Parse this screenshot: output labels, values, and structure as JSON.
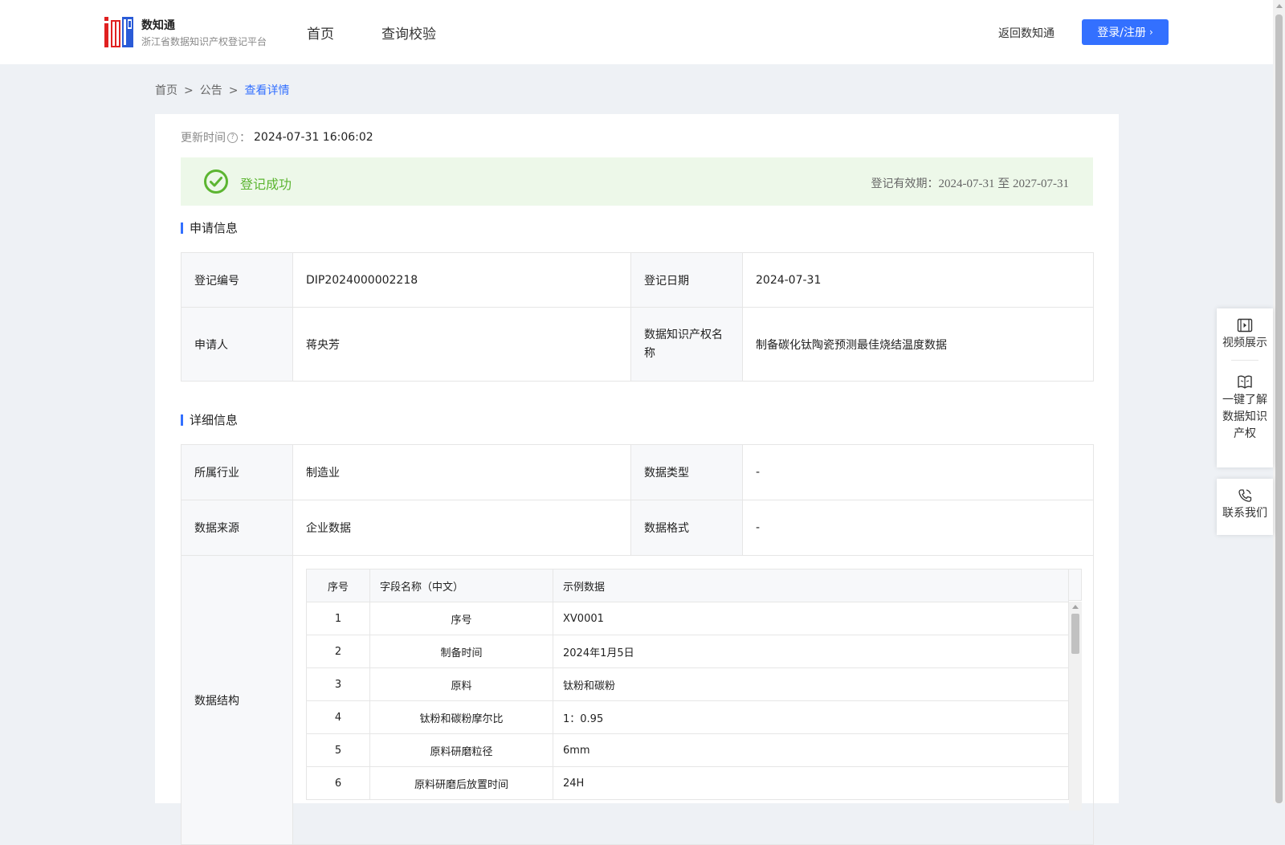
{
  "header": {
    "logo_title": "数知通",
    "logo_subtitle": "浙江省数据知识产权登记平台",
    "nav": [
      "首页",
      "查询校验"
    ],
    "back_link": "返回数知通",
    "login_button": "登录/注册"
  },
  "breadcrumb": [
    "首页",
    "公告",
    "查看详情"
  ],
  "update": {
    "label": "更新时间",
    "suffix": "：",
    "value": "2024-07-31 16:06:02"
  },
  "status": {
    "text": "登记成功",
    "validity_label": "登记有效期：",
    "validity_range": "2024-07-31 至 2027-07-31",
    "color": "#5cb531"
  },
  "apply_info": {
    "title": "申请信息",
    "rows": [
      {
        "label1": "登记编号",
        "value1": "DIP2024000002218",
        "label2": "登记日期",
        "value2": "2024-07-31"
      },
      {
        "label1": "申请人",
        "value1": "蒋央芳",
        "label2": "数据知识产权名称",
        "value2": "制备碳化钛陶瓷预测最佳烧结温度数据"
      }
    ]
  },
  "detail_info": {
    "title": "详细信息",
    "rows": [
      {
        "label1": "所属行业",
        "value1": "制造业",
        "label2": "数据类型",
        "value2": "-"
      },
      {
        "label1": "数据来源",
        "value1": "企业数据",
        "label2": "数据格式",
        "value2": "-"
      }
    ],
    "structure_label": "数据结构",
    "structure_headers": [
      "序号",
      "字段名称（中文）",
      "示例数据"
    ],
    "structure_rows": [
      {
        "idx": "1",
        "name": "序号",
        "example": "XV0001"
      },
      {
        "idx": "2",
        "name": "制备时间",
        "example": "2024年1月5日"
      },
      {
        "idx": "3",
        "name": "原料",
        "example": "钛粉和碳粉"
      },
      {
        "idx": "4",
        "name": "钛粉和碳粉摩尔比",
        "example": "1：0.95"
      },
      {
        "idx": "5",
        "name": "原料研磨粒径",
        "example": "6mm"
      },
      {
        "idx": "6",
        "name": "原料研磨后放置时间",
        "example": "24H"
      }
    ]
  },
  "side_panel": {
    "video": "视频展示",
    "learn": "一键了解数据知识产权",
    "contact": "联系我们"
  },
  "colors": {
    "accent": "#3370ff",
    "success": "#5cb531",
    "success_bg": "#edf8e9"
  }
}
